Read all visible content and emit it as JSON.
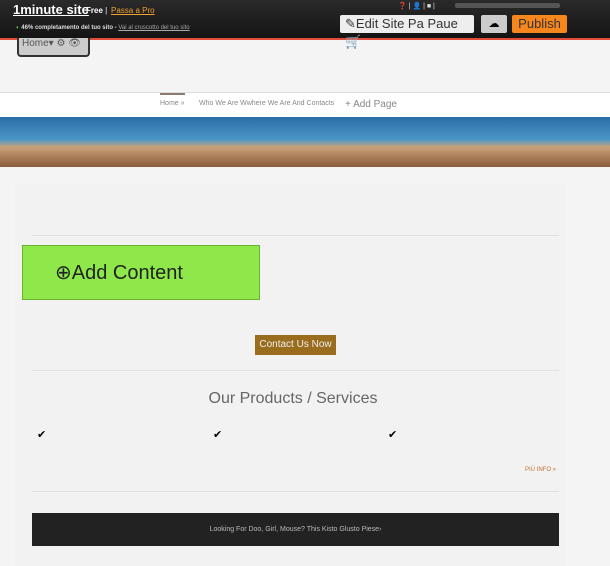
{
  "topbar": {
    "logo": "1minute site",
    "plan": "Free",
    "separator": "|",
    "upgrade": "Passa a Pro",
    "progress_text": "46% completamento del tuo sito -",
    "progress_link": "Vai al cruscotto del tuo sito",
    "progress_percent": 46,
    "edit_label": "Edit Site Pa Paue",
    "publish_label": "Publish"
  },
  "page_tab": {
    "label": "Home▾"
  },
  "nav": {
    "items": [
      "Home »",
      "Who We Are Wwhere We Are And Contacts"
    ],
    "add_page": "+ Add Page"
  },
  "content": {
    "add_content": "Add Content",
    "contact_button": "Contact Us Now",
    "products_title": "Our Products / Services",
    "more_link": "PIÙ INFO »",
    "footer_text": "Looking For Doo, Girl, Mouse? This Kisto Glusto Piese›"
  },
  "colors": {
    "publish": "#f7861c",
    "add_content": "#8ee84a",
    "accent": "#e04b3a"
  }
}
